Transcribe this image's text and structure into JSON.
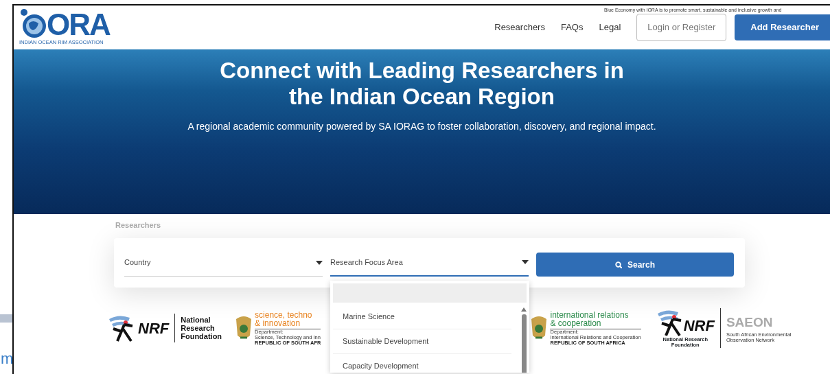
{
  "backdrop": {
    "top_text": "Blue Economy with IORA is to promote smart, sustainable and inclusive growth and",
    "side_text": "m"
  },
  "navbar": {
    "logo": {
      "letters": "ORA",
      "tagline": "INDIAN OCEAN RIM ASSOCIATION"
    },
    "links": [
      {
        "label": "Researchers"
      },
      {
        "label": "FAQs"
      },
      {
        "label": "Legal"
      }
    ],
    "login_button": "Login or Register",
    "add_button": "Add Researcher"
  },
  "hero": {
    "title_lines": [
      "Connect with Leading Researchers in",
      "the Indian Ocean Region"
    ],
    "subtitle": "A regional academic community powered by SA IORAG to foster collaboration, discovery, and regional impact."
  },
  "section_label": "Researchers",
  "search": {
    "country": {
      "placeholder": "Country"
    },
    "focus_area": {
      "placeholder": "Research Focus Area",
      "expanded": true,
      "options": [
        {
          "label": "Marine Science",
          "selected": false
        },
        {
          "label": "Sustainable Development",
          "selected": false
        },
        {
          "label": "Capacity Development",
          "selected": false
        }
      ]
    },
    "button": "Search"
  },
  "logos": [
    {
      "kind": "nrf",
      "mark": "NRF",
      "lines": [
        "National",
        "Research",
        "Foundation"
      ]
    },
    {
      "kind": "department",
      "color": "#e8821e",
      "lines": [
        "science, techno",
        "& innovation"
      ],
      "small": [
        "Department:",
        "Science, Technology and Inn"
      ],
      "country": "REPUBLIC OF SOUTH AFR"
    },
    {
      "kind": "department",
      "color": "#2a8a4a",
      "lines": [
        "international relations",
        "& cooperation"
      ],
      "small": [
        "Department:",
        "International Relations and Cooperation"
      ],
      "country": "REPUBLIC OF SOUTH AFRICA"
    },
    {
      "kind": "saeon",
      "mark": "NRF",
      "lines": [
        "National Research",
        "Foundation"
      ],
      "name": "SAEON",
      "sub": [
        "South African Environmental",
        "Observation Network"
      ]
    }
  ]
}
